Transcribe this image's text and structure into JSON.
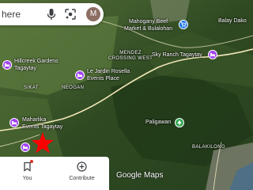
{
  "search": {
    "text": "here"
  },
  "avatar": {
    "letter": "M"
  },
  "places": {
    "balay_dako": "Balay Dako",
    "mahogany_beef": "Mahogany Beef\nMarket & Bulalohan",
    "hillcreek": "Hillcreek Gardens\nTagaytay",
    "le_jardin": "Le Jardin Rosella\nEvents Place",
    "sky_ranch": "Sky Ranch Tagaytay",
    "maharlika": "Maharlika\nEvents Tagaytay",
    "paligawan": "Paligawan"
  },
  "areas": {
    "mendez": "MENDEZ\nCROSSING WEST",
    "sikat": "SIKAT",
    "neogan": "NEOGAN",
    "balakilong": "BALAKILONG"
  },
  "nav": {
    "you_label": "You",
    "contribute_label": "Contribute"
  },
  "branding": {
    "google_maps": "Google Maps"
  },
  "colors": {
    "lodging_pin": "#a142f4",
    "shopping_pin": "#1a73e8",
    "park_pin": "#34a853",
    "marker": "#ff0000"
  },
  "icons": [
    "mic-icon",
    "google-lens-icon",
    "bookmark-icon",
    "add-circle-icon",
    "hotel-icon",
    "shopping-cart-icon",
    "park-icon",
    "star-marker-icon"
  ]
}
